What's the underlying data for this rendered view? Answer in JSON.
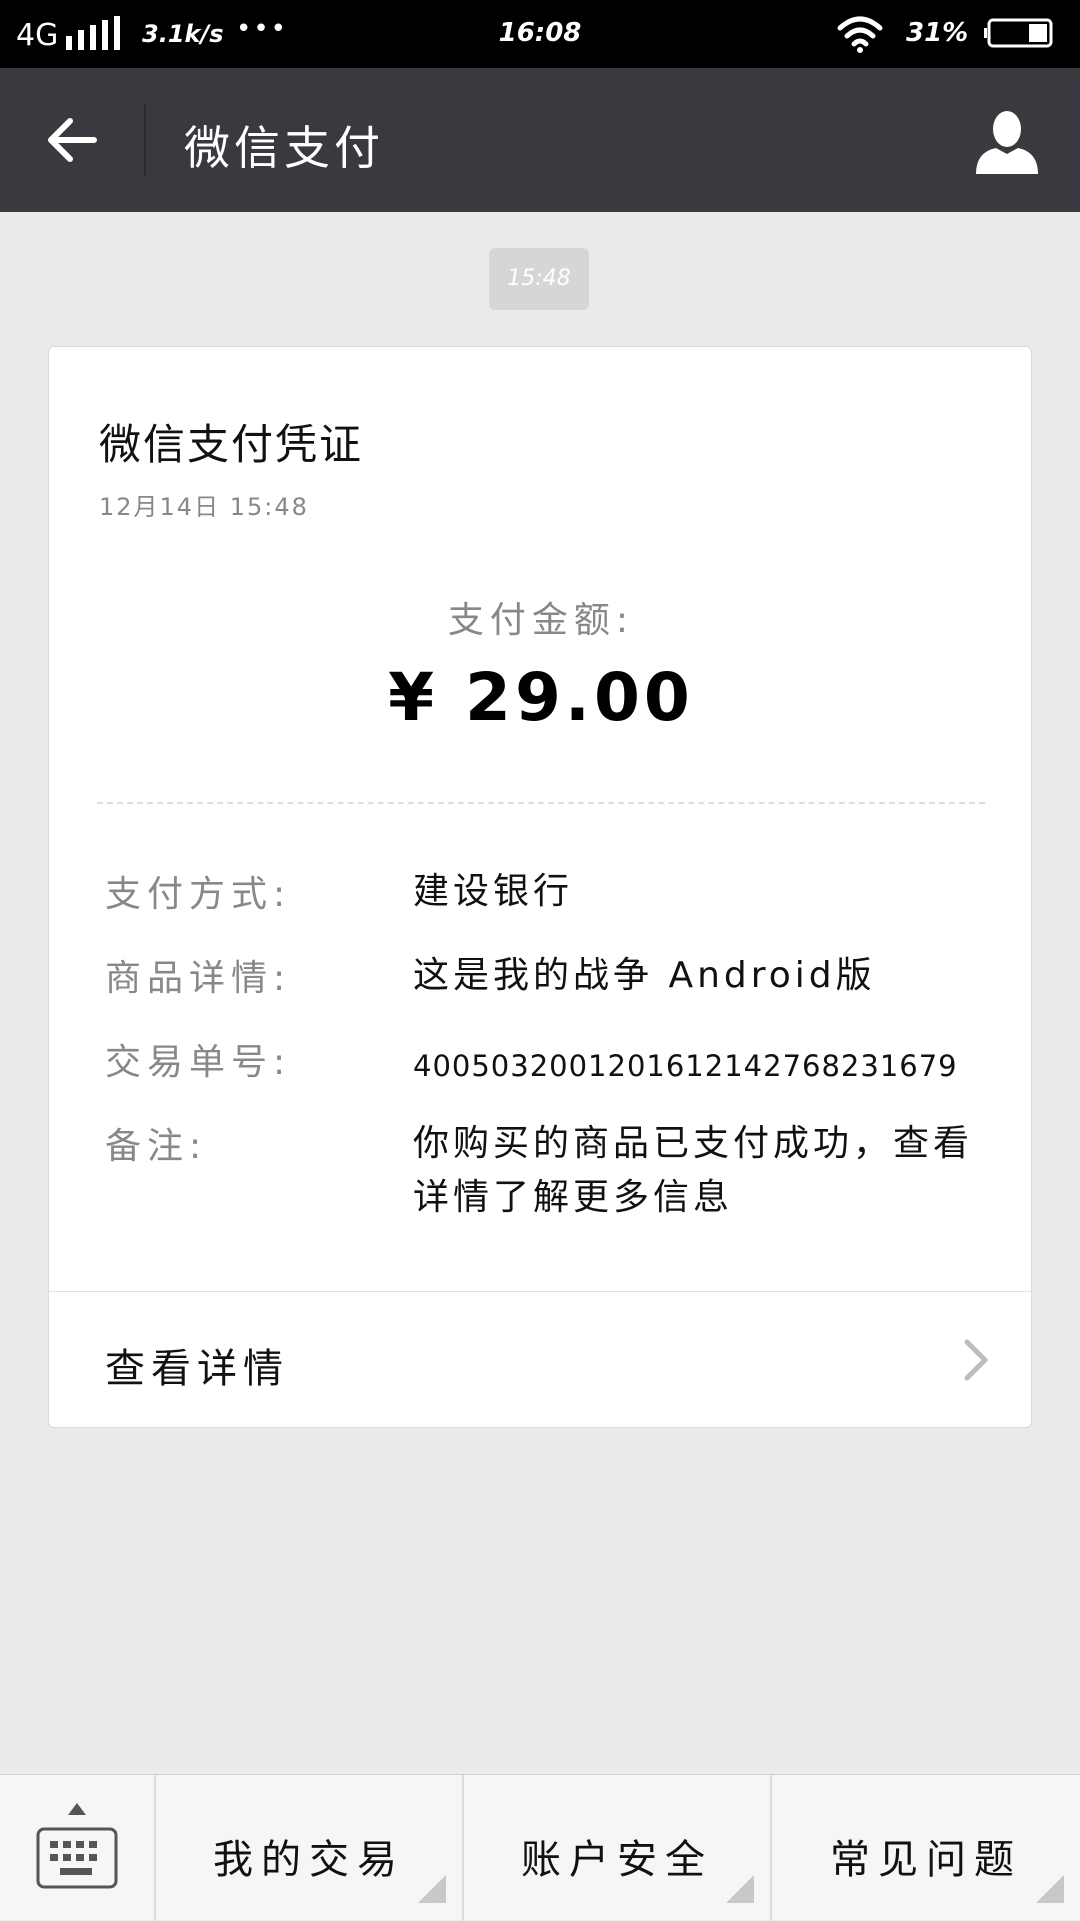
{
  "status_bar": {
    "network": "4G",
    "speed": "3.1k/s",
    "more": "•••",
    "time": "16:08",
    "battery_percent": "31%",
    "battery_level": 0.31,
    "signal_icon": "signal-bars-icon",
    "wifi_icon": "wifi-icon",
    "battery_icon": "battery-icon"
  },
  "header": {
    "title": "微信支付",
    "back_icon": "back-arrow-icon",
    "profile_icon": "person-icon",
    "background": "#393a3f"
  },
  "message_time": "15:48",
  "receipt": {
    "title": "微信支付凭证",
    "date": "12月14日  15:48",
    "amount_label": "支付金额:",
    "amount": "¥ 29.00",
    "details": [
      {
        "label": "支付方式:",
        "value": "建设银行"
      },
      {
        "label": "商品详情:",
        "value": "这是我的战争 Android版"
      },
      {
        "label": "交易单号:",
        "value": "4005032001201612142768231679"
      },
      {
        "label": "备注:",
        "value": "你购买的商品已支付成功，查看详情了解更多信息"
      }
    ],
    "view_details": "查看详情",
    "chevron_icon": "chevron-right-icon"
  },
  "bottom_bar": {
    "keyboard_icon": "keyboard-icon",
    "menus": [
      {
        "label": "我的交易"
      },
      {
        "label": "账户安全"
      },
      {
        "label": "常见问题"
      }
    ]
  }
}
